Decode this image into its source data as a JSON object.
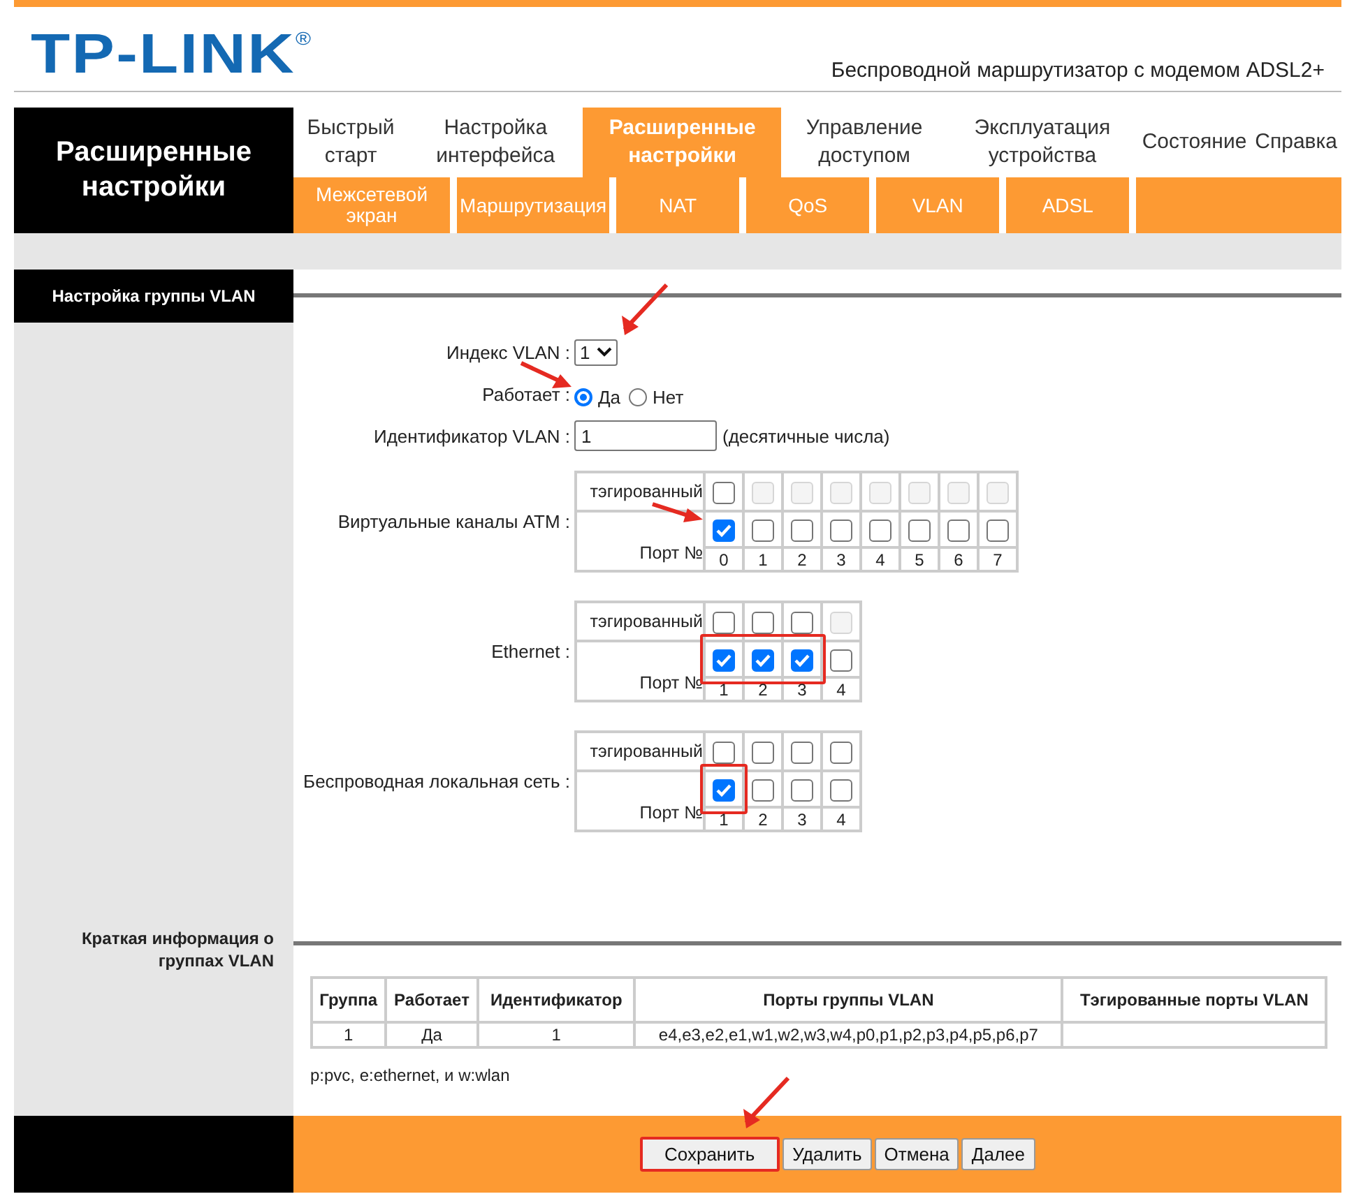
{
  "header": {
    "logo": "TP-LINK",
    "logo_mark": "®",
    "subtitle": "Беспроводной маршрутизатор с модемом ADSL2+"
  },
  "nav": {
    "section_title": "Расширенные настройки",
    "menu": [
      {
        "label": "Быстрый старт",
        "selected": false
      },
      {
        "label": "Настройка интерфейса",
        "selected": false
      },
      {
        "label": "Расширенные настройки",
        "selected": true
      },
      {
        "label": "Управление доступом",
        "selected": false
      },
      {
        "label": "Эксплуатация устройства",
        "selected": false
      },
      {
        "label": "Состояние",
        "selected": false
      },
      {
        "label": "Справка",
        "selected": false
      }
    ],
    "submenu": [
      "Межсетевой экран",
      "Маршрутизация",
      "NAT",
      "QoS",
      "VLAN",
      "ADSL"
    ]
  },
  "vlan_group": {
    "title": "Настройка группы VLAN",
    "index": {
      "label": "Индекс VLAN :",
      "value": "1",
      "pointed_at": true
    },
    "enabled": {
      "label": "Работает :",
      "options": [
        {
          "label": "Да",
          "selected": true,
          "pointed_at": true
        },
        {
          "label": "Нет",
          "selected": false
        }
      ]
    },
    "vlan_id": {
      "label": "Идентификатор VLAN :",
      "value": "1",
      "hint": "(десятичные числа)"
    },
    "port_groups": [
      {
        "label": "Виртуальные каналы ATM :",
        "tagged_label": "тэгированный",
        "port_label": "Порт №",
        "ports": [
          {
            "number": "0",
            "tagged": false,
            "tagged_disabled": false,
            "member": true,
            "highlighted": false,
            "pointed_at": true
          },
          {
            "number": "1",
            "tagged": false,
            "tagged_disabled": true,
            "member": false,
            "highlighted": false
          },
          {
            "number": "2",
            "tagged": false,
            "tagged_disabled": true,
            "member": false,
            "highlighted": false
          },
          {
            "number": "3",
            "tagged": false,
            "tagged_disabled": true,
            "member": false,
            "highlighted": false
          },
          {
            "number": "4",
            "tagged": false,
            "tagged_disabled": true,
            "member": false,
            "highlighted": false
          },
          {
            "number": "5",
            "tagged": false,
            "tagged_disabled": true,
            "member": false,
            "highlighted": false
          },
          {
            "number": "6",
            "tagged": false,
            "tagged_disabled": true,
            "member": false,
            "highlighted": false
          },
          {
            "number": "7",
            "tagged": false,
            "tagged_disabled": true,
            "member": false,
            "highlighted": false
          }
        ]
      },
      {
        "label": "Ethernet :",
        "tagged_label": "тэгированный",
        "port_label": "Порт №",
        "ports": [
          {
            "number": "1",
            "tagged": false,
            "tagged_disabled": false,
            "member": true,
            "highlighted": true
          },
          {
            "number": "2",
            "tagged": false,
            "tagged_disabled": false,
            "member": true,
            "highlighted": true
          },
          {
            "number": "3",
            "tagged": false,
            "tagged_disabled": false,
            "member": true,
            "highlighted": true
          },
          {
            "number": "4",
            "tagged": false,
            "tagged_disabled": true,
            "member": false,
            "highlighted": false
          }
        ]
      },
      {
        "label": "Беспроводная локальная сеть :",
        "tagged_label": "тэгированный",
        "port_label": "Порт №",
        "ports": [
          {
            "number": "1",
            "tagged": false,
            "tagged_disabled": false,
            "member": true,
            "highlighted": true
          },
          {
            "number": "2",
            "tagged": false,
            "tagged_disabled": false,
            "member": false,
            "highlighted": false
          },
          {
            "number": "3",
            "tagged": false,
            "tagged_disabled": false,
            "member": false,
            "highlighted": false
          },
          {
            "number": "4",
            "tagged": false,
            "tagged_disabled": false,
            "member": false,
            "highlighted": false
          }
        ]
      }
    ]
  },
  "summary": {
    "title": "Краткая информация о группах VLAN",
    "columns": [
      "Группа",
      "Работает",
      "Идентификатор",
      "Порты группы VLAN",
      "Тэгированные порты VLAN"
    ],
    "rows": [
      {
        "group": "1",
        "enabled": "Да",
        "id": "1",
        "ports": "e4,e3,e2,e1,w1,w2,w3,w4,p0,p1,p2,p3,p4,p5,p6,p7"
      }
    ],
    "legend": "p:pvc, e:ethernet, и w:wlan"
  },
  "buttons": [
    {
      "label": "Сохранить",
      "highlighted": true,
      "pointed_at": true
    },
    {
      "label": "Удалить",
      "highlighted": false
    },
    {
      "label": "Отмена",
      "highlighted": false
    },
    {
      "label": "Далее",
      "highlighted": false
    }
  ]
}
